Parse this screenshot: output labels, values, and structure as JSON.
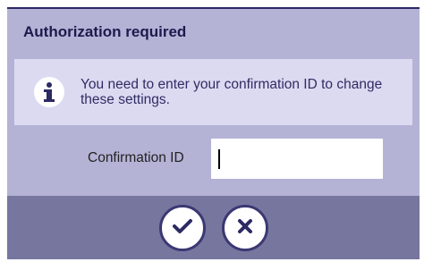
{
  "dialog": {
    "title": "Authorization required",
    "info_icon": "info-icon",
    "info_text": "You need to enter your confirmation ID to change these settings.",
    "field_label": "Confirmation ID",
    "field_value": "",
    "confirm_icon": "checkmark-icon",
    "cancel_icon": "close-icon"
  },
  "colors": {
    "panel": "#b4b3d6",
    "info_band": "#dcdaf1",
    "footer": "#77769f",
    "title_text": "#1d1a4d",
    "icon_dark": "#2c2a63"
  }
}
